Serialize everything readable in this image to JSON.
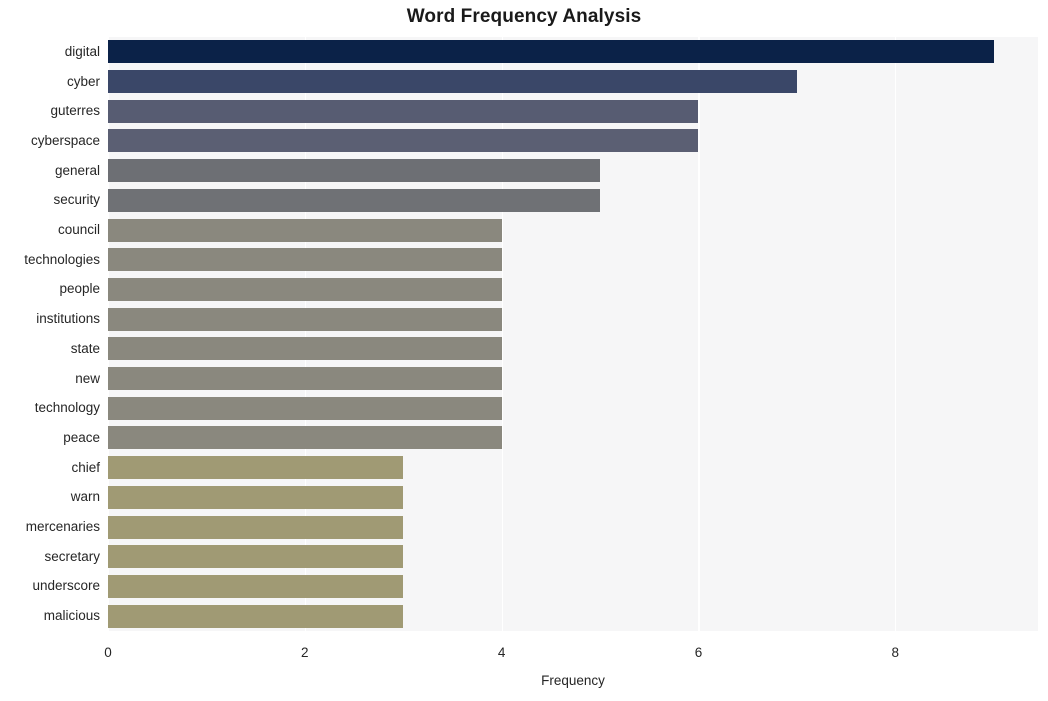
{
  "chart_data": {
    "type": "bar",
    "orientation": "horizontal",
    "title": "Word Frequency Analysis",
    "xlabel": "Frequency",
    "ylabel": "",
    "categories": [
      "digital",
      "cyber",
      "guterres",
      "cyberspace",
      "general",
      "security",
      "council",
      "technologies",
      "people",
      "institutions",
      "state",
      "new",
      "technology",
      "peace",
      "chief",
      "warn",
      "mercenaries",
      "secretary",
      "underscore",
      "malicious"
    ],
    "values": [
      9,
      7,
      6,
      6,
      5,
      5,
      4,
      4,
      4,
      4,
      4,
      4,
      4,
      4,
      3,
      3,
      3,
      3,
      3,
      3
    ],
    "bar_colors": [
      "#0b2248",
      "#3a4768",
      "#575c72",
      "#5b5f73",
      "#6d6f74",
      "#6f7175",
      "#8a887e",
      "#8a887e",
      "#8a887e",
      "#8a887e",
      "#8a887e",
      "#8a887e",
      "#8a887e",
      "#8a887e",
      "#a09a74",
      "#a09a74",
      "#a09a74",
      "#a09a74",
      "#a09a74",
      "#a09a74"
    ],
    "xlim": [
      0,
      9.45
    ],
    "xticks": [
      0,
      2,
      4,
      6,
      8
    ],
    "xtick_labels": [
      "0",
      "2",
      "4",
      "6",
      "8"
    ],
    "grid": "vertical-white-on-light-gray",
    "legend": null,
    "plot_background": "#f6f6f7",
    "figure_background": "#ffffff"
  }
}
